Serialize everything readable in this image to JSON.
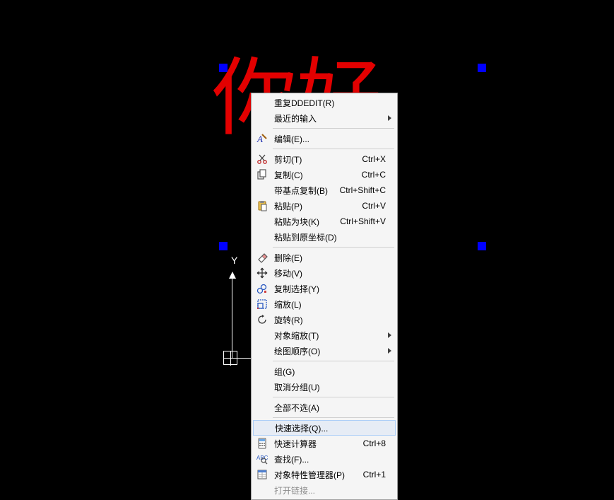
{
  "canvas": {
    "text1": "你好",
    "ucs_y": "Y"
  },
  "menu": {
    "repeat": "重复DDEDIT(R)",
    "recent": "最近的输入",
    "edit": "编辑(E)...",
    "cut": "剪切(T)",
    "cut_sc": "Ctrl+X",
    "copy": "复制(C)",
    "copy_sc": "Ctrl+C",
    "copy_base": "带基点复制(B)",
    "copy_base_sc": "Ctrl+Shift+C",
    "paste": "粘贴(P)",
    "paste_sc": "Ctrl+V",
    "paste_block": "粘贴为块(K)",
    "paste_block_sc": "Ctrl+Shift+V",
    "paste_orig": "粘贴到原坐标(D)",
    "erase": "删除(E)",
    "move": "移动(V)",
    "copy_sel": "复制选择(Y)",
    "zoom": "缩放(L)",
    "rotate": "旋转(R)",
    "obj_scale": "对象缩放(T)",
    "draw_order": "绘图顺序(O)",
    "group": "组(G)",
    "ungroup": "取消分组(U)",
    "deselect": "全部不选(A)",
    "qselect": "快速选择(Q)...",
    "qcalc": "快速计算器",
    "qcalc_sc": "Ctrl+8",
    "find": "查找(F)...",
    "props": "对象特性管理器(P)",
    "props_sc": "Ctrl+1",
    "open_link": "打开链接..."
  }
}
